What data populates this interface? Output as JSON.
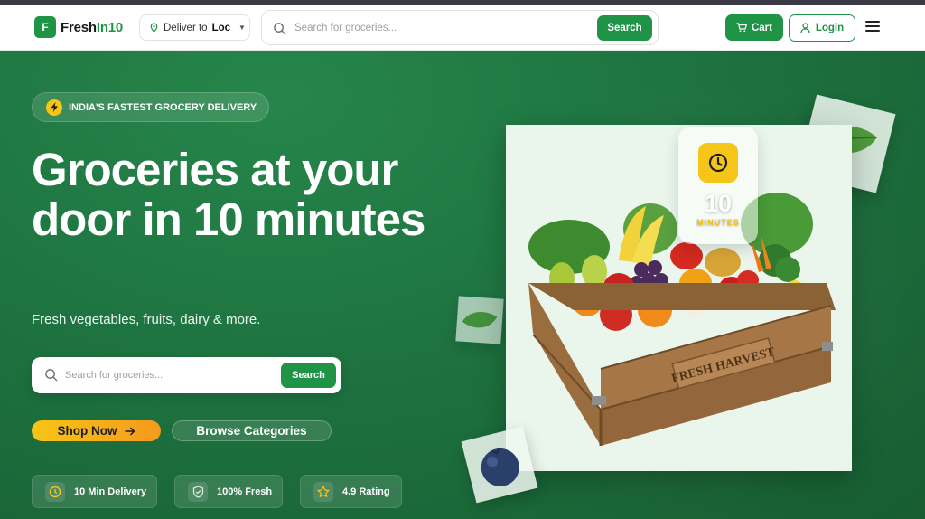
{
  "header": {
    "logo_mark": "F",
    "logo_text_primary": "Fresh",
    "logo_text_accent": "In10",
    "deliver_label": "Deliver to",
    "deliver_location": "Loc",
    "search_placeholder": "Search for groceries...",
    "search_button": "Search",
    "cart_label": "Cart",
    "login_label": "Login"
  },
  "hero": {
    "badge_text": "INDIA'S FASTEST GROCERY DELIVERY",
    "headline": "Groceries at your door in 10 minutes",
    "subheadline": "Fresh vegetables, fruits, dairy & more.",
    "search_placeholder": "Search for groceries...",
    "search_button": "Search",
    "shop_now": "Shop Now",
    "browse_categories": "Browse Categories",
    "stats": [
      {
        "label": "10 Min Delivery",
        "icon": "clock-icon"
      },
      {
        "label": "100% Fresh",
        "icon": "shield-icon"
      },
      {
        "label": "4.9 Rating",
        "icon": "star-icon"
      }
    ],
    "timer": {
      "value": "10",
      "unit": "MINUTES"
    },
    "crate_label": "FRESH HARVEST"
  },
  "colors": {
    "brand_green": "#1f9447",
    "hero_bg": "#1e7340",
    "accent_yellow": "#f5c518",
    "accent_orange": "#f49a1d"
  }
}
